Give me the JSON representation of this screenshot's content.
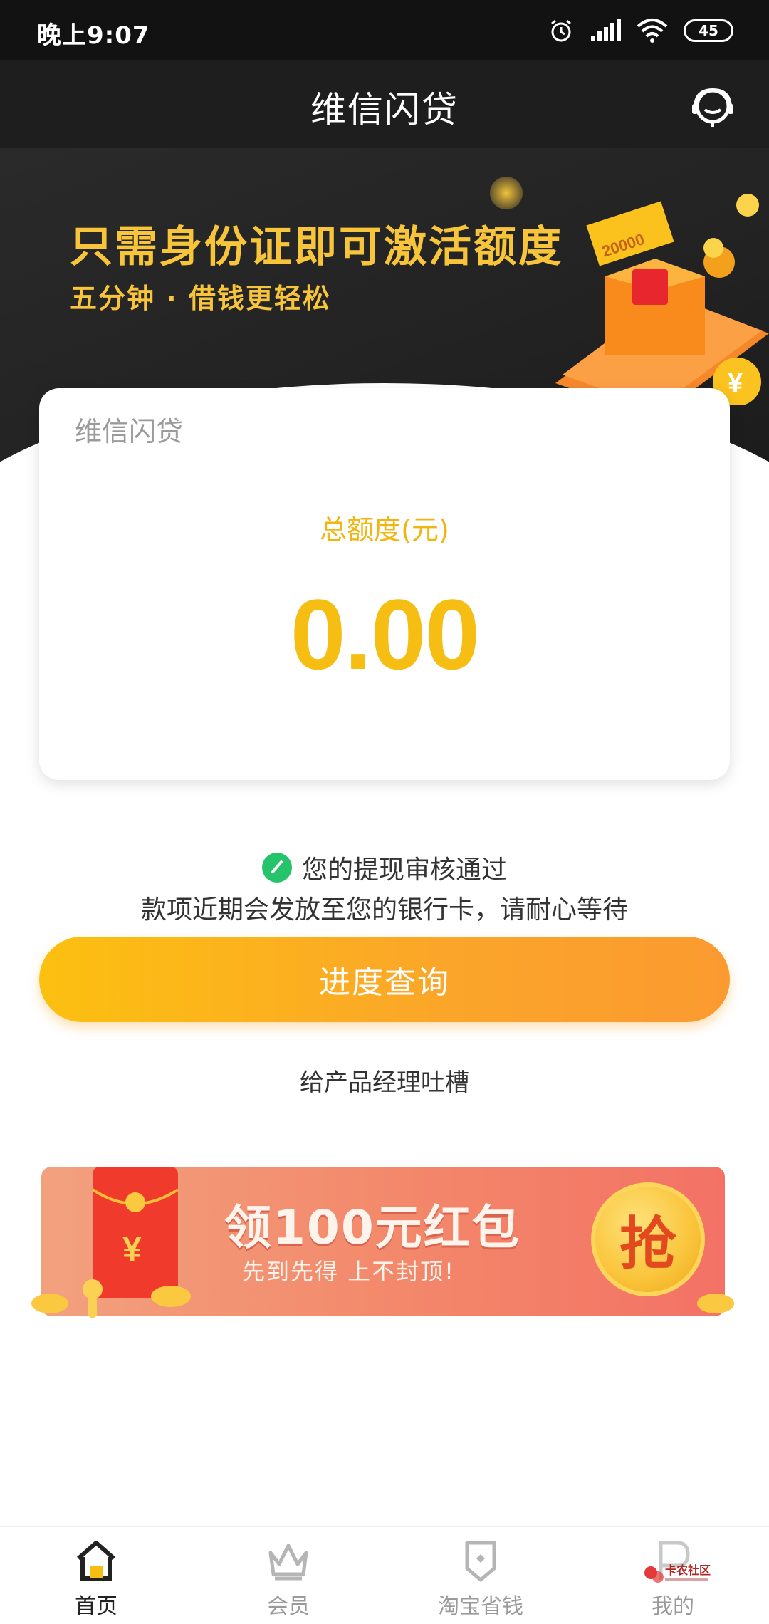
{
  "status_bar": {
    "time": "晚上9:07",
    "battery": "45"
  },
  "header": {
    "title": "维信闪贷"
  },
  "banner": {
    "headline": "只需身份证即可激活额度",
    "subline": "五分钟 · 借钱更轻松",
    "art_amount": "20000"
  },
  "card": {
    "brand": "维信闪贷",
    "quota_label": "总额度(元)",
    "quota_value": "0.00"
  },
  "notice": {
    "line1": "您的提现审核通过",
    "line2": "款项近期会发放至您的银行卡，请耐心等待"
  },
  "actions": {
    "progress_button": "进度查询",
    "feedback_link": "给产品经理吐槽"
  },
  "promo": {
    "title": "领100元红包",
    "subtitle": "先到先得 上不封顶!",
    "grab": "抢",
    "envelope_symbol": "¥"
  },
  "bottom_nav": {
    "items": [
      {
        "label": "首页",
        "active": true
      },
      {
        "label": "会员",
        "active": false
      },
      {
        "label": "淘宝省钱",
        "active": false
      },
      {
        "label": "我的",
        "active": false
      }
    ]
  },
  "watermark": {
    "text": "卡农社区"
  },
  "colors": {
    "accent": "#f6bd12",
    "button_start": "#fcc010",
    "button_end": "#fb9a30",
    "header_bg": "#1e1e1e",
    "success": "#25c36a"
  }
}
